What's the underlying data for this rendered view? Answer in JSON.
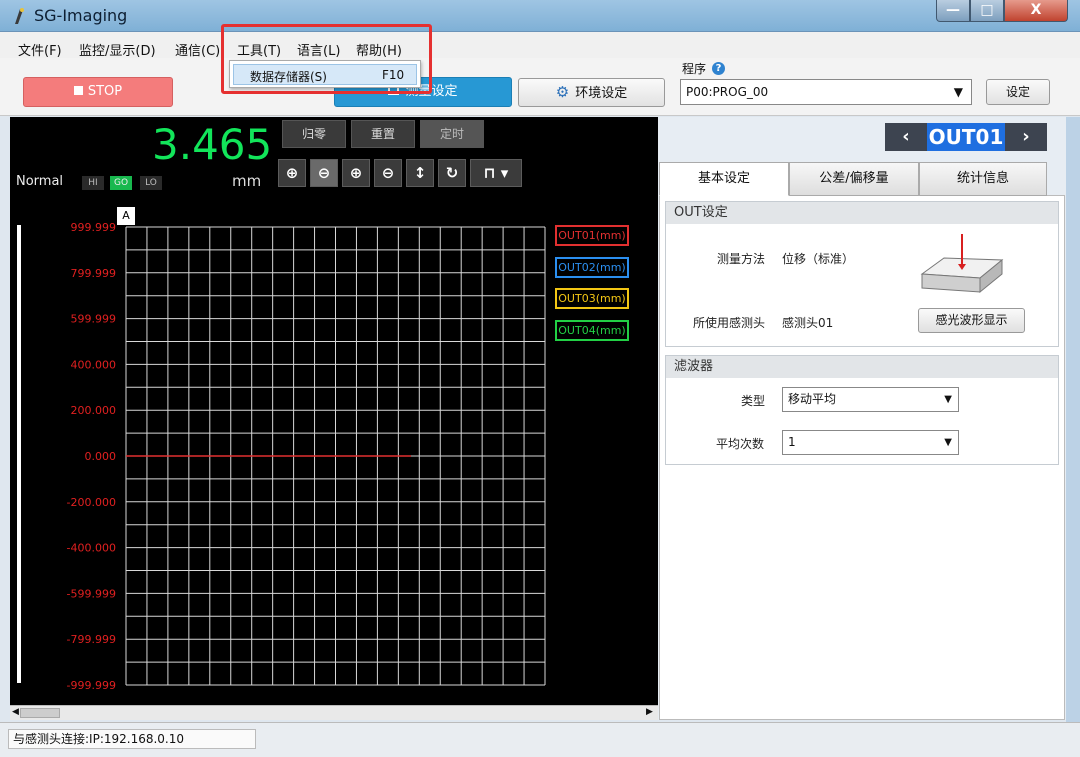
{
  "window": {
    "title": "SG-Imaging",
    "min": "—",
    "max": "□",
    "close": "X"
  },
  "menu": [
    "文件(F)",
    "监控/显示(D)",
    "通信(C)",
    "工具(T)",
    "语言(L)",
    "帮助(H)"
  ],
  "dropdown": {
    "item_label": "数据存储器(S)",
    "item_shortcut": "F10"
  },
  "toolbar": {
    "stop_label": "STOP",
    "measure_label": "测量设定",
    "env_label": "环境设定",
    "program_label": "程序",
    "program_value": "P00:PROG_00",
    "set_label": "设定"
  },
  "readout": {
    "value": "3.465",
    "unit": "mm",
    "mode": "Normal",
    "hi": "HI",
    "go": "GO",
    "lo": "LO"
  },
  "controls": {
    "zero": "归零",
    "reset": "重置",
    "timer": "定时"
  },
  "chart_data": {
    "type": "line",
    "ylabels": [
      "999.999",
      "799.999",
      "599.999",
      "400.000",
      "200.000",
      "0.000",
      "-200.000",
      "-400.000",
      "-599.999",
      "-799.999",
      "-999.999"
    ],
    "ylim": [
      -999.999,
      999.999
    ],
    "grid": true,
    "marker": "A",
    "series": [
      {
        "name": "OUT01(mm)",
        "color": "#e23030",
        "value": 0.0
      },
      {
        "name": "OUT02(mm)",
        "color": "#2b8ff0"
      },
      {
        "name": "OUT03(mm)",
        "color": "#f2c614"
      },
      {
        "name": "OUT04(mm)",
        "color": "#22d045"
      }
    ]
  },
  "right": {
    "out_name": "OUT01",
    "tabs": [
      "基本设定",
      "公差/偏移量",
      "统计信息"
    ],
    "out_group": {
      "title": "OUT设定",
      "method_label": "测量方法",
      "method_value": "位移（标准）",
      "sensor_label": "所使用感测头",
      "sensor_value": "感测头01",
      "wave_button": "感光波形显示"
    },
    "filter_group": {
      "title": "滤波器",
      "type_label": "类型",
      "type_value": "移动平均",
      "count_label": "平均次数",
      "count_value": "1"
    }
  },
  "status": {
    "text": "与感测头连接:IP:192.168.0.10"
  }
}
